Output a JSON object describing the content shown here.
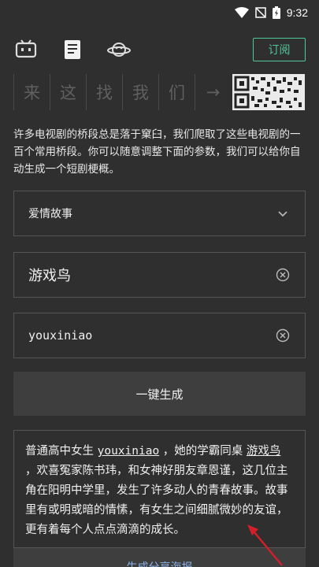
{
  "status": {
    "time": "9:32",
    "icons": [
      "wifi-icon",
      "no-signal-icon",
      "battery-icon"
    ]
  },
  "toolbar": {
    "icons": [
      "tv-icon",
      "book-icon",
      "planet-icon"
    ],
    "subscribe_label": "订阅"
  },
  "banner": {
    "chars": [
      "来",
      "这",
      "找",
      "我",
      "们",
      "→"
    ]
  },
  "description": "许多电视剧的桥段总是落于窠臼，我们爬取了这些电视剧的一百个常用桥段。你可以随意调整下面的参数，我们可以给你自动生成一个短剧梗概。",
  "form": {
    "genre": "爱情故事",
    "name1": "游戏鸟",
    "name2": "youxiniao",
    "generate_label": "一键生成"
  },
  "result": {
    "part1": "普通高中女生 ",
    "name_a": "youxiniao",
    "part2": " ，她的学霸同桌 ",
    "name_b": "游戏鸟",
    "part3": " ，欢喜冤家陈书玮，和女神好朋友章恩谨，这几位主角在阳明中学里，发生了许多动人的青春故事。故事里有或明或暗的情愫，有女生之间细腻微妙的友谊，更有着每个人点点滴滴的成长。"
  },
  "share_label": "生成分享海报",
  "colors": {
    "accent": "#4fc89a",
    "background": "#2f2f2f",
    "annotation_arrow": "#d21f2a"
  }
}
